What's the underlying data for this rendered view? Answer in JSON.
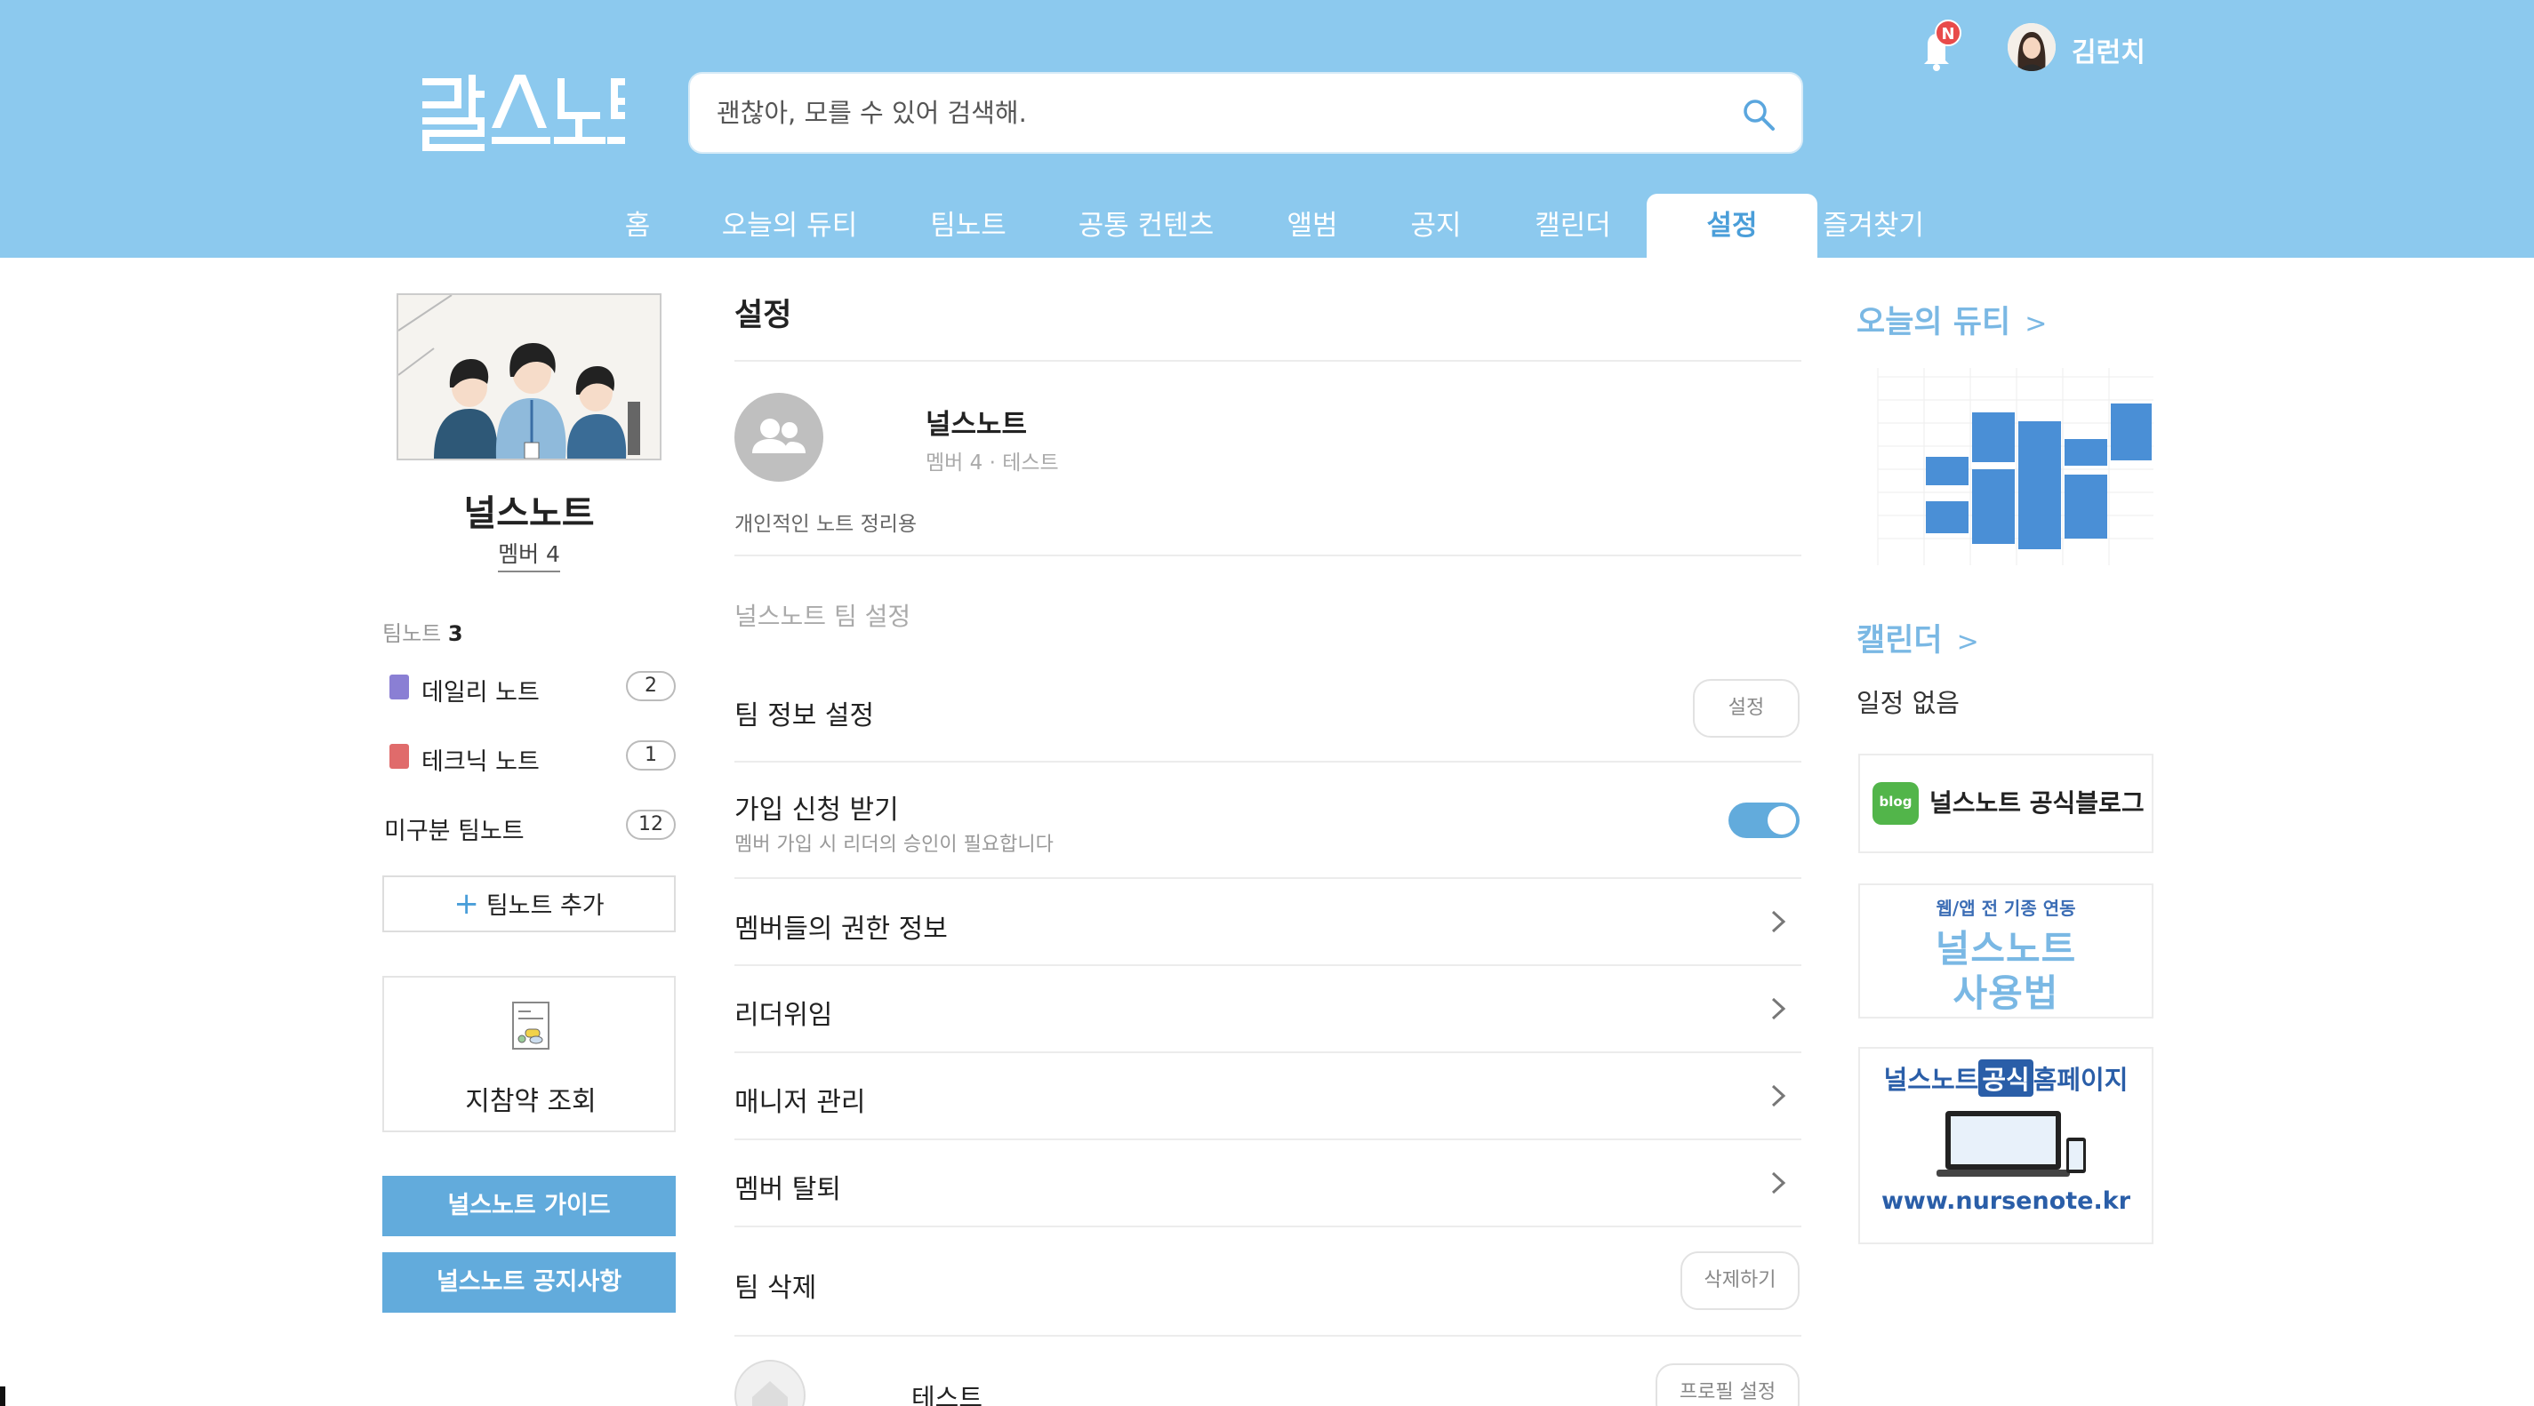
{
  "header": {
    "logo_alt": "널스노트",
    "search_placeholder": "괜찮아, 모를 수 있어 검색해.",
    "notification_badge": "N",
    "username": "김런치"
  },
  "nav": [
    {
      "label": "홈",
      "active": false
    },
    {
      "label": "오늘의 듀티",
      "active": false
    },
    {
      "label": "팀노트",
      "active": false
    },
    {
      "label": "공통 컨텐츠",
      "active": false
    },
    {
      "label": "앨범",
      "active": false
    },
    {
      "label": "공지",
      "active": false
    },
    {
      "label": "캘린더",
      "active": false
    },
    {
      "label": "설정",
      "active": true
    },
    {
      "label": "즐겨찾기",
      "active": false
    }
  ],
  "sidebar": {
    "team_name": "널스노트",
    "members": "멤버 4",
    "teamnote_label": "팀노트",
    "teamnote_count": "3",
    "notes": [
      {
        "label": "데일리 노트",
        "count": "2",
        "color": "#8a7fd4"
      },
      {
        "label": "테크닉 노트",
        "count": "1",
        "color": "#e06b6b"
      },
      {
        "label": "미구분 팀노트",
        "count": "12",
        "color": ""
      }
    ],
    "add_note": "팀노트 추가",
    "guideline": "지참약 조회",
    "guide_button": "널스노트 가이드",
    "notice_button": "널스노트 공지사항"
  },
  "main": {
    "title": "설정",
    "team": {
      "name": "널스노트",
      "sub": "멤버 4 · 테스트",
      "desc": "개인적인 노트 정리용"
    },
    "section": "널스노트 팀 설정",
    "rows": {
      "team_info": "팀 정보 설정",
      "team_info_btn": "설정",
      "join": "가입 신청 받기",
      "join_sub": "멤버 가입 시 리더의 승인이 필요합니다",
      "join_enabled": true,
      "permissions": "멤버들의 권한 정보",
      "delegate": "리더위임",
      "manager": "매니저 관리",
      "withdraw": "멤버 탈퇴",
      "delete": "팀 삭제",
      "delete_btn": "삭제하기"
    },
    "member": {
      "name": "테스트",
      "profile_btn": "프로필 설정"
    }
  },
  "right": {
    "duty_title": "오늘의 듀티",
    "calendar_title": "캘린더",
    "no_schedule": "일정 없음",
    "blog_icon": "blog",
    "blog": "널스노트 공식블로그",
    "howto_top": "웹/앱 전 기종 연동",
    "howto_line1": "널스노트",
    "howto_line2": "사용법",
    "home_prefix": "널스노트",
    "home_badge": "공식",
    "home_suffix": "홈페이지",
    "home_url": "www.nursenote.kr"
  },
  "colors": {
    "header_bg": "#8cc9ee",
    "accent": "#62abdc",
    "active_tab_text": "#4a9ed9"
  }
}
